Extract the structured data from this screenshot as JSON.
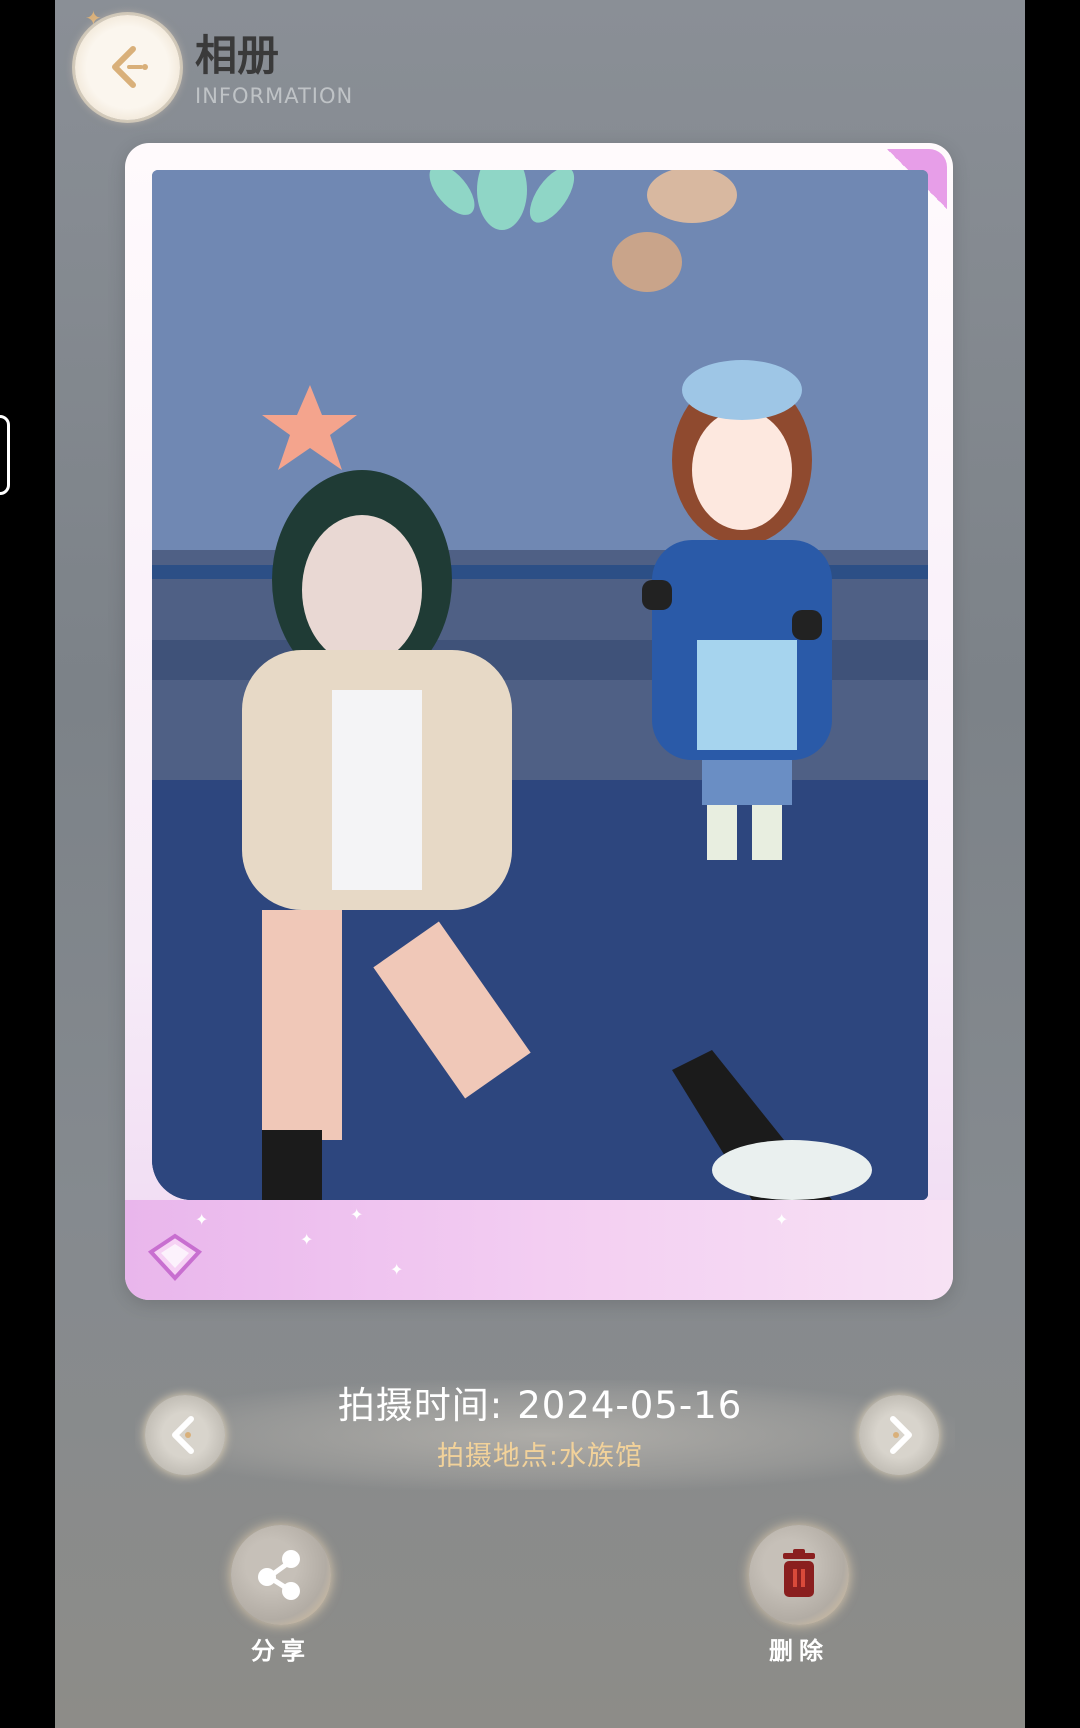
{
  "header": {
    "title": "相册",
    "subtitle": "INFORMATION"
  },
  "photo": {
    "description_icon": "photo-image"
  },
  "info": {
    "date_label": "拍摄时间:",
    "date_value": "2024-05-16",
    "location_label": "拍摄地点:",
    "location_value": "水族馆"
  },
  "actions": {
    "share_label": "分享",
    "delete_label": "删除"
  },
  "colors": {
    "accent_gold": "#f2d29a",
    "card_pink": "#e9b6ec",
    "delete_red": "#8a1f1f"
  }
}
